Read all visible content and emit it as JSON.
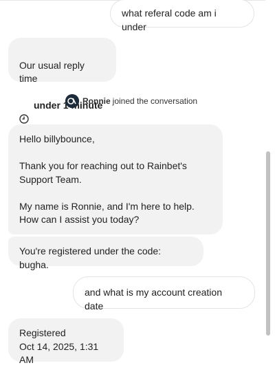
{
  "messages": [
    {
      "from": "user",
      "text": "what referal code am i under"
    },
    {
      "from": "system",
      "title": "Our usual reply time",
      "value": "under 1 minute",
      "icon": "clock-icon"
    },
    {
      "from": "event",
      "name": "Ronnie",
      "text": "joined the conversation"
    },
    {
      "from": "agent",
      "text": "Hello billybounce,\n\nThank you for reaching out to Rainbet's Support Team.\n\nMy name is Ronnie, and I'm here to help. How can I assist you today?"
    },
    {
      "from": "agent",
      "text": "You're registered under the code: bugha."
    },
    {
      "from": "user",
      "text": "and what is my account creation date"
    },
    {
      "from": "agent",
      "text": "Registered\nOct 14, 2025, 1:31 AM"
    }
  ],
  "colors": {
    "agent_bubble": "#f2f2f3",
    "user_border": "#e3e3e3",
    "avatar": "#1e2b3a"
  }
}
